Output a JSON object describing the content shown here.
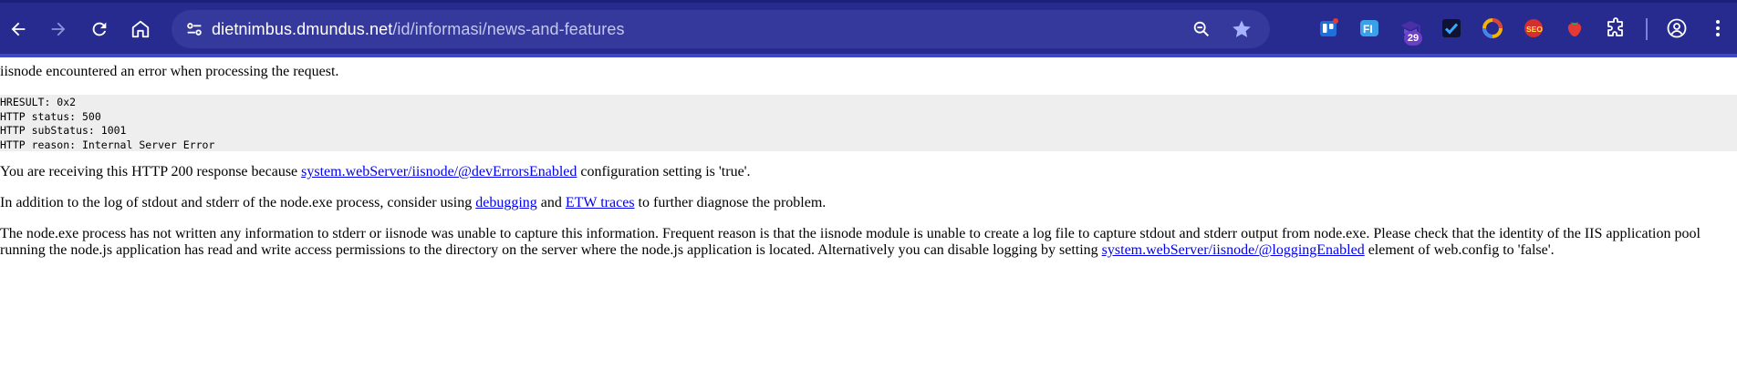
{
  "browser": {
    "url_host": "dietnimbus.dmundus.net",
    "url_path": "/id/informasi/news-and-features",
    "extension_badge": "29",
    "icons": {
      "back": "back-arrow-icon",
      "forward": "forward-arrow-icon",
      "reload": "reload-icon",
      "home": "home-icon",
      "site_info": "site-info-tune-icon",
      "zoom": "zoom-icon",
      "bookmark": "star-icon",
      "extensions": [
        "trello-icon",
        "fi-icon",
        "graduation-cap-icon",
        "checkbox-icon",
        "color-ring-icon",
        "seo-icon",
        "strawberry-icon",
        "puzzle-icon",
        "profile-icon",
        "more-vert-icon"
      ]
    },
    "colors": {
      "toolbar": "#272b8f",
      "omnibox": "#35399c",
      "accent": "#3f48c9"
    }
  },
  "page": {
    "heading": "iisnode encountered an error when processing the request.",
    "details": [
      "HRESULT: 0x2",
      "HTTP status: 500",
      "HTTP subStatus: 1001",
      "HTTP reason: Internal Server Error"
    ],
    "p1_before": "You are receiving this HTTP 200 response because ",
    "p1_link": "system.webServer/iisnode/@devErrorsEnabled",
    "p1_after": " configuration setting is 'true'.",
    "p2_before": "In addition to the log of stdout and stderr of the node.exe process, consider using ",
    "p2_link1": "debugging",
    "p2_mid": " and ",
    "p2_link2": "ETW traces",
    "p2_after": " to further diagnose the problem.",
    "p3_before": "The node.exe process has not written any information to stderr or iisnode was unable to capture this information. Frequent reason is that the iisnode module is unable to create a log file to capture stdout and stderr output from node.exe. Please check that the identity of the IIS application pool running the node.js application has read and write access permissions to the directory on the server where the node.js application is located. Alternatively you can disable logging by setting ",
    "p3_link": "system.webServer/iisnode/@loggingEnabled",
    "p3_after": " element of web.config to 'false'."
  }
}
